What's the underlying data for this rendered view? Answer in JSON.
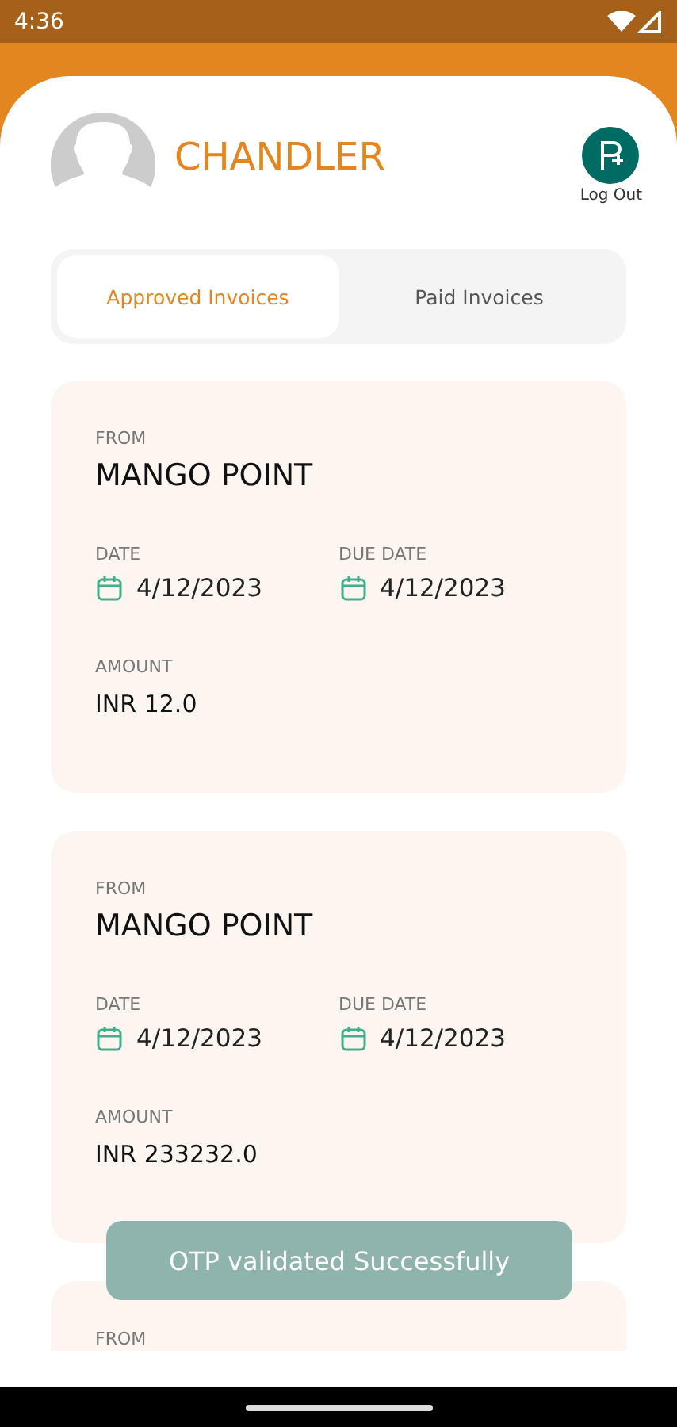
{
  "status_bar": {
    "time": "4:36"
  },
  "header": {
    "user_name": "CHANDLER",
    "logout_label": "Log Out"
  },
  "tabs": [
    {
      "label": "Approved Invoices",
      "selected": true
    },
    {
      "label": "Paid Invoices",
      "selected": false
    }
  ],
  "invoices": [
    {
      "from_label": "FROM",
      "from": "MANGO POINT",
      "date_label": "DATE",
      "date": "4/12/2023",
      "due_label": "DUE DATE",
      "due_date": "4/12/2023",
      "amount_label": "AMOUNT",
      "amount": "INR 12.0"
    },
    {
      "from_label": "FROM",
      "from": "MANGO POINT",
      "date_label": "DATE",
      "date": "4/12/2023",
      "due_label": "DUE DATE",
      "due_date": "4/12/2023",
      "amount_label": "AMOUNT",
      "amount": "INR 233232.0"
    },
    {
      "from_label": "FROM"
    }
  ],
  "toast": "OTP validated Successfully"
}
